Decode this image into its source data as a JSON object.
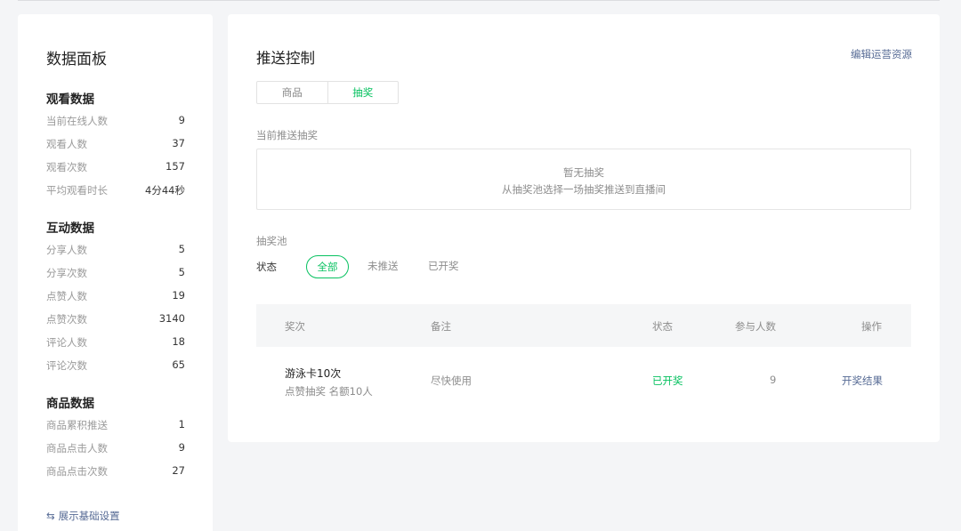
{
  "sidebar": {
    "title": "数据面板",
    "groups": [
      {
        "title": "观看数据",
        "rows": [
          {
            "label": "当前在线人数",
            "value": "9"
          },
          {
            "label": "观看人数",
            "value": "37"
          },
          {
            "label": "观看次数",
            "value": "157"
          },
          {
            "label": "平均观看时长",
            "value": "4分44秒"
          }
        ]
      },
      {
        "title": "互动数据",
        "rows": [
          {
            "label": "分享人数",
            "value": "5"
          },
          {
            "label": "分享次数",
            "value": "5"
          },
          {
            "label": "点赞人数",
            "value": "19"
          },
          {
            "label": "点赞次数",
            "value": "3140"
          },
          {
            "label": "评论人数",
            "value": "18"
          },
          {
            "label": "评论次数",
            "value": "65"
          }
        ]
      },
      {
        "title": "商品数据",
        "rows": [
          {
            "label": "商品累积推送",
            "value": "1"
          },
          {
            "label": "商品点击人数",
            "value": "9"
          },
          {
            "label": "商品点击次数",
            "value": "27"
          }
        ]
      }
    ],
    "bottom_link": {
      "icon": "swap-icon",
      "glyph": "⇆",
      "label": "展示基础设置"
    }
  },
  "main": {
    "title": "推送控制",
    "edit_link": "编辑运营资源",
    "tabs": [
      {
        "label": "商品",
        "active": false
      },
      {
        "label": "抽奖",
        "active": true
      }
    ],
    "current_label": "当前推送抽奖",
    "empty": {
      "line1": "暂无抽奖",
      "line2": "从抽奖池选择一场抽奖推送到直播间"
    },
    "pool_label": "抽奖池",
    "filter": {
      "label": "状态",
      "options": [
        {
          "label": "全部",
          "active": true
        },
        {
          "label": "未推送",
          "active": false
        },
        {
          "label": "已开奖",
          "active": false
        }
      ]
    },
    "table": {
      "headers": {
        "prize": "奖次",
        "note": "备注",
        "status": "状态",
        "participants": "参与人数",
        "action": "操作"
      },
      "rows": [
        {
          "prize": "游泳卡10次",
          "prize_sub": "点赞抽奖 名额10人",
          "note": "尽快使用",
          "status": "已开奖",
          "participants": "9",
          "action": "开奖结果"
        }
      ]
    }
  },
  "colors": {
    "accent_green": "#07c160",
    "link_blue": "#576b95"
  }
}
